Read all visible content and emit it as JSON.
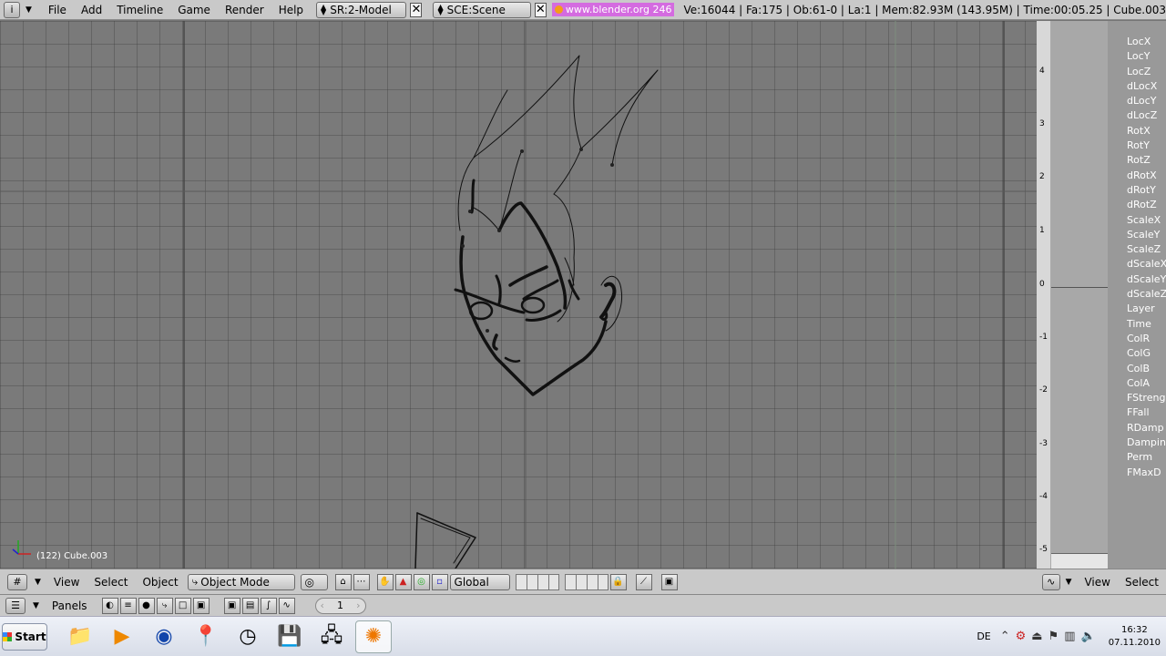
{
  "topbar": {
    "info_icon": "i",
    "menus": [
      "File",
      "Add",
      "Timeline",
      "Game",
      "Render",
      "Help"
    ],
    "screen": "SR:2-Model",
    "scene": "SCE:Scene",
    "url": "www.blender.org 246",
    "stats": "Ve:16044 | Fa:175 | Ob:61-0 | La:1  | Mem:82.93M (143.95M)  | Time:00:05.25 | Cube.003"
  },
  "viewport": {
    "info": "(122) Cube.003"
  },
  "ipo": {
    "ticks": [
      "4",
      "3",
      "2",
      "1",
      "0",
      "-1",
      "-2",
      "-3",
      "-4",
      "-5"
    ],
    "channels": [
      "LocX",
      "LocY",
      "LocZ",
      "dLocX",
      "dLocY",
      "dLocZ",
      "RotX",
      "RotY",
      "RotZ",
      "dRotX",
      "dRotY",
      "dRotZ",
      "ScaleX",
      "ScaleY",
      "ScaleZ",
      "dScaleX",
      "dScaleY",
      "dScaleZ",
      "Layer",
      "Time",
      "ColR",
      "ColG",
      "ColB",
      "ColA",
      "FStreng",
      "FFall",
      "RDamp",
      "Damping",
      "Perm",
      "FMaxD"
    ]
  },
  "vp_header": {
    "view": "View",
    "select": "Select",
    "object": "Object",
    "mode": "Object Mode",
    "orientation": "Global"
  },
  "ipo_header": {
    "view": "View",
    "select": "Select"
  },
  "btn_header": {
    "panels": "Panels",
    "frame": "1"
  },
  "taskbar": {
    "start": "Start",
    "lang": "DE",
    "time": "16:32",
    "date": "07.11.2010"
  },
  "colors": {
    "accent": "#d46be0",
    "viewport_bg": "#7a7a7a",
    "header_bg": "#c9c9c9"
  }
}
